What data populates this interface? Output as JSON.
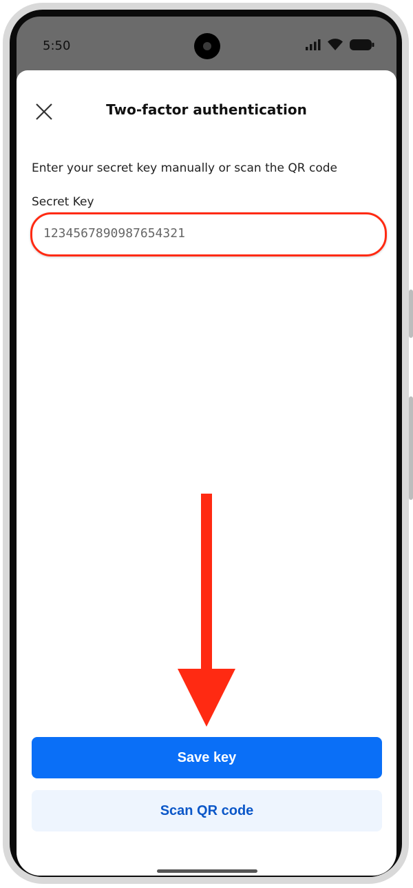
{
  "status_bar": {
    "time": "5:50",
    "icons": [
      "signal-icon",
      "wifi-icon",
      "battery-icon"
    ]
  },
  "header": {
    "title": "Two-factor authentication",
    "close_icon": "close-icon"
  },
  "form": {
    "instructions": "Enter your secret key manually or scan the QR code",
    "secret_key_label": "Secret Key",
    "secret_key_value": "1234567890987654321",
    "highlight_color": "#ff2a12"
  },
  "buttons": {
    "save_key": "Save key",
    "scan_qr": "Scan QR code"
  },
  "colors": {
    "primary": "#0a6ff7",
    "secondary_bg": "#eef5fe",
    "secondary_text": "#0b57c8",
    "annotation": "#ff2a12"
  }
}
